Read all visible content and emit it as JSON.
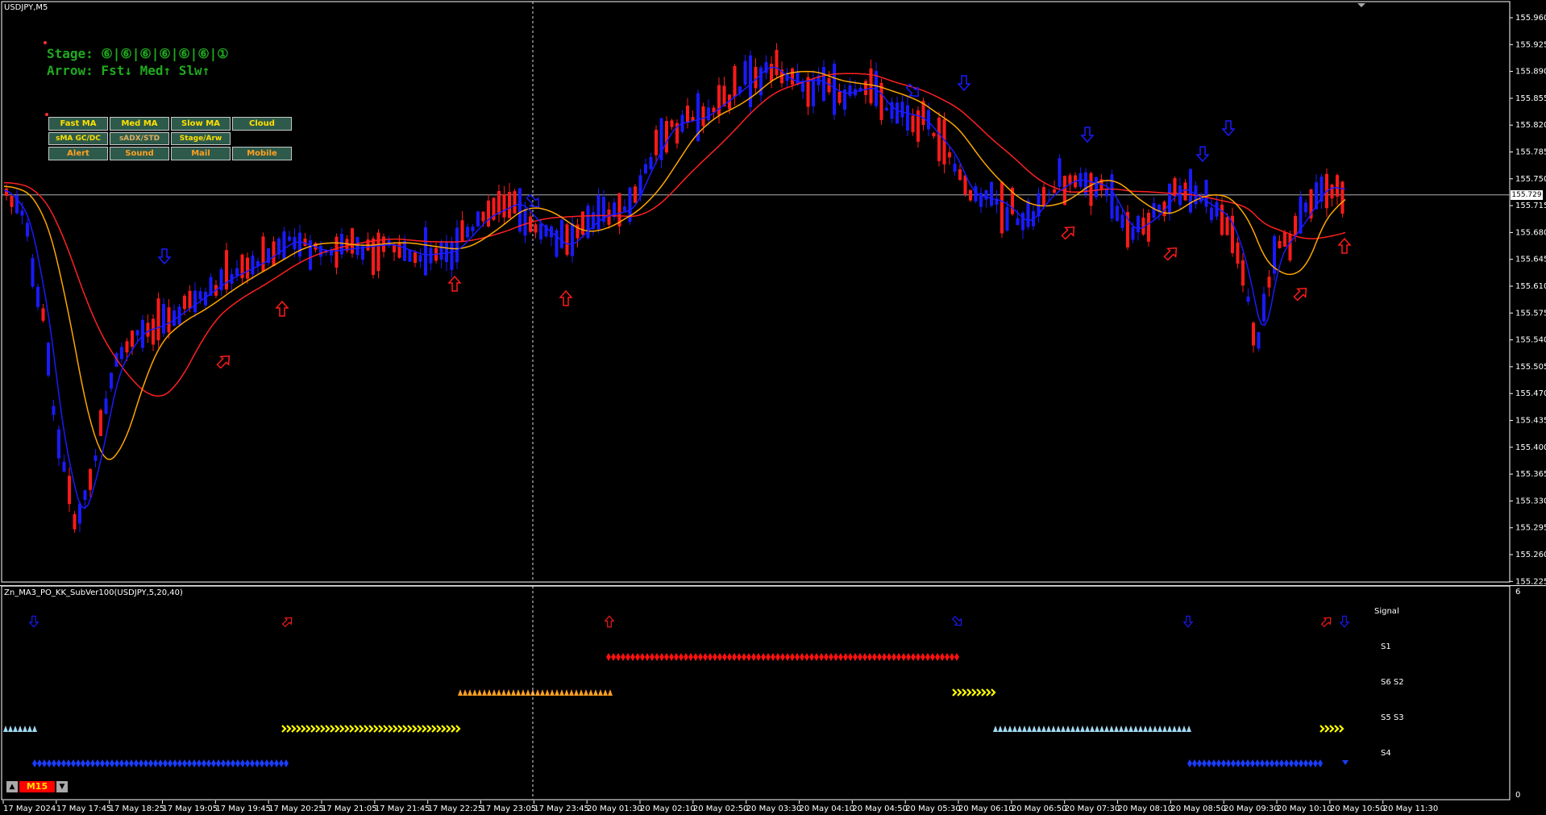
{
  "symbol_label": "USDJPY,M5",
  "indicator_label": "Zn_MA3_PO_KK_SubVer100(USDJPY,5,20,40)",
  "info": {
    "stage_line": "Stage: ⑥|⑥|⑥|⑥|⑥|⑥|①",
    "arrow_line": "Arrow: Fst↓ Med↑ Slw↑"
  },
  "buttons": [
    {
      "label": "Fast MA"
    },
    {
      "label": "Med MA"
    },
    {
      "label": "Slow MA"
    },
    {
      "label": "Cloud"
    },
    {
      "label": "sMA GC/DC"
    },
    {
      "label": "sADX/STD"
    },
    {
      "label": "Stage/Arw"
    },
    {
      "label": "Alert"
    },
    {
      "label": "Sound"
    },
    {
      "label": "Mail"
    },
    {
      "label": "Mobile"
    }
  ],
  "current_price": "155.729",
  "price_axis": [
    "155.960",
    "155.925",
    "155.890",
    "155.855",
    "155.820",
    "155.785",
    "155.750",
    "155.715",
    "155.680",
    "155.645",
    "155.610",
    "155.575",
    "155.540",
    "155.505",
    "155.470",
    "155.435",
    "155.400",
    "155.365",
    "155.330",
    "155.295",
    "155.260",
    "155.225"
  ],
  "sub_axis": {
    "top": "6",
    "bottom": "0"
  },
  "sub_rows": [
    "Signal",
    "S1",
    "S6 S2",
    "S5 S3",
    "S4"
  ],
  "time_axis": [
    "17 May 2024",
    "17 May 17:45",
    "17 May 18:25",
    "17 May 19:05",
    "17 May 19:45",
    "17 May 20:25",
    "17 May 21:05",
    "17 May 21:45",
    "17 May 22:25",
    "17 May 23:05",
    "17 May 23:45",
    "20 May 01:30",
    "20 May 02:10",
    "20 May 02:50",
    "20 May 03:30",
    "20 May 04:10",
    "20 May 04:50",
    "20 May 05:30",
    "20 May 06:10",
    "20 May 06:50",
    "20 May 07:30",
    "20 May 08:10",
    "20 May 08:50",
    "20 May 09:30",
    "20 May 10:10",
    "20 May 10:50",
    "20 May 11:30"
  ],
  "timeframe": {
    "label": "M15",
    "up": "▲",
    "down": "▼"
  },
  "colors": {
    "bull": "#ff1a1a",
    "bear": "#1a1aff",
    "fast_ma": "#1a1aff",
    "med_ma": "#ffa500",
    "slow_ma": "#ff2020",
    "yellow": "#ffff00",
    "light_blue": "#a0d8f0",
    "orange": "#ffa020"
  }
}
